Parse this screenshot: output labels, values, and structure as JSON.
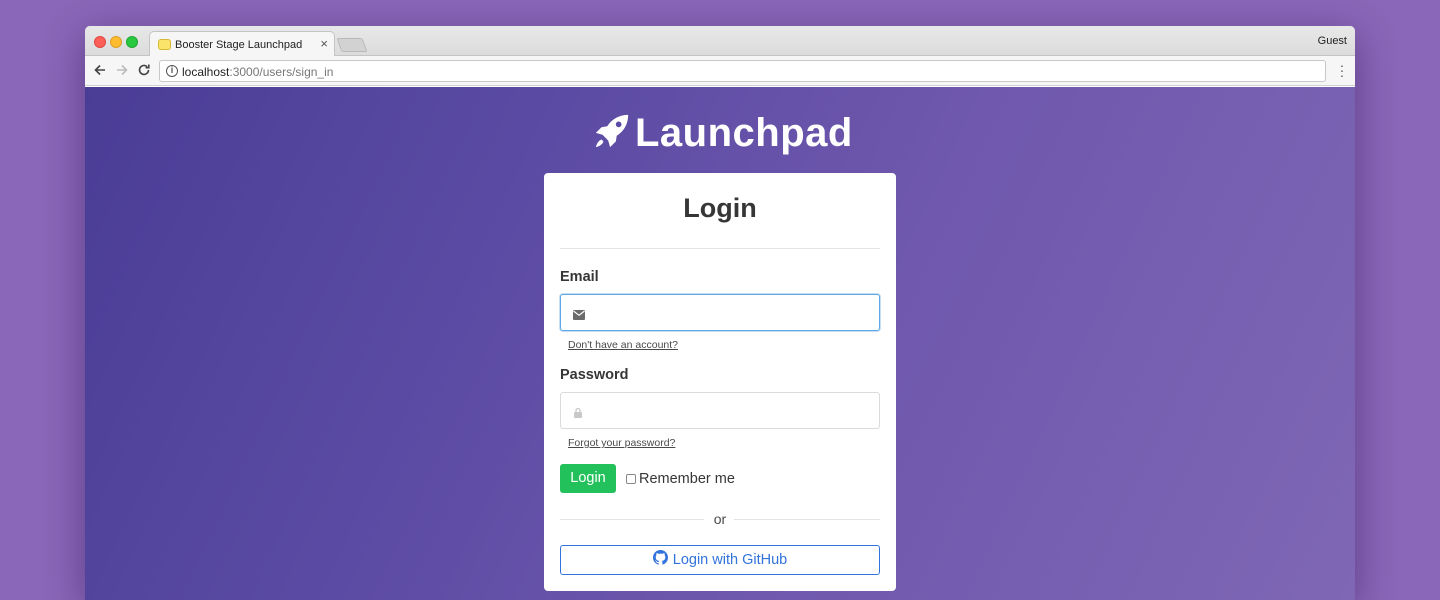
{
  "browser": {
    "tab_title": "Booster Stage Launchpad",
    "tab_close": "×",
    "profile": "Guest",
    "url_host": "localhost",
    "url_path": ":3000/users/sign_in"
  },
  "brand": {
    "name": "Launchpad"
  },
  "login": {
    "title": "Login",
    "email_label": "Email",
    "email_value": "",
    "signup_link": "Don't have an account?",
    "password_label": "Password",
    "password_value": "",
    "forgot_link": "Forgot your password?",
    "submit_label": "Login",
    "remember_label": "Remember me",
    "remember_checked": false,
    "or_text": "or",
    "github_label": "Login with GitHub"
  },
  "colors": {
    "background": "#8a67b8",
    "content_gradient_start": "#4a3d96",
    "content_gradient_end": "#7f67b5",
    "primary_button": "#23c15c",
    "link_blue": "#3273dc",
    "focus_border": "#5fa7e5"
  },
  "icons": {
    "brand": "rocket-icon",
    "email": "envelope-icon",
    "password": "lock-icon",
    "github": "github-icon",
    "address_info": "info-icon"
  }
}
